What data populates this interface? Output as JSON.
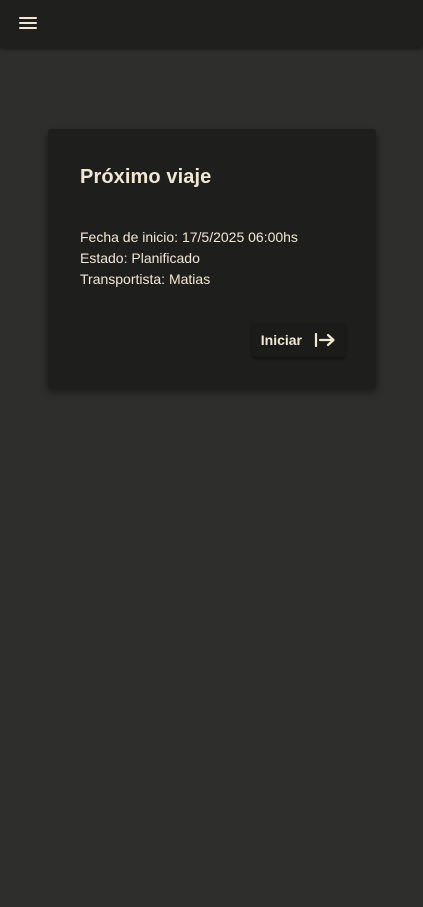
{
  "appbar": {
    "menu_icon": "menu-icon"
  },
  "card": {
    "title": "Próximo viaje",
    "lines": [
      "Fecha de inicio: 17/5/2025 06:00hs",
      "Estado: Planificado",
      "Transportista: Matias"
    ],
    "action": {
      "label": "Iniciar",
      "icon": "start-arrow-icon"
    }
  },
  "colors": {
    "background": "#2e2e2c",
    "appbar": "#1f1f1d",
    "card": "#1e1e1d",
    "text": "#f2e6d4"
  }
}
